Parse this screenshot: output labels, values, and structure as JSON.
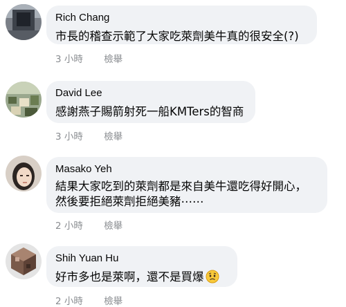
{
  "comments": [
    {
      "name": "Rich Chang",
      "text": "市長的稽查示範了大家吃萊劑美牛真的很安全(?)",
      "time": "3 小時",
      "action": "檢舉"
    },
    {
      "name": "David Lee",
      "text": "感謝燕子賜箭射死一船KMTers的智商",
      "time": "3 小時",
      "action": "檢舉"
    },
    {
      "name": "Masako Yeh",
      "text": "結果大家吃到的萊劑都是來自美牛還吃得好開心，\n然後要拒絕萊劑拒絕美豬⋯⋯",
      "time": "2 小時",
      "action": "檢舉"
    },
    {
      "name": "Shih Yuan Hu",
      "text": "好市多也是萊啊，還不是買爆",
      "emoji": "worried-face-icon",
      "time": "2 小時",
      "action": "檢舉"
    }
  ],
  "colors": {
    "bubble": "#f0f2f5",
    "meta": "#8a8d91",
    "text": "#050505"
  }
}
